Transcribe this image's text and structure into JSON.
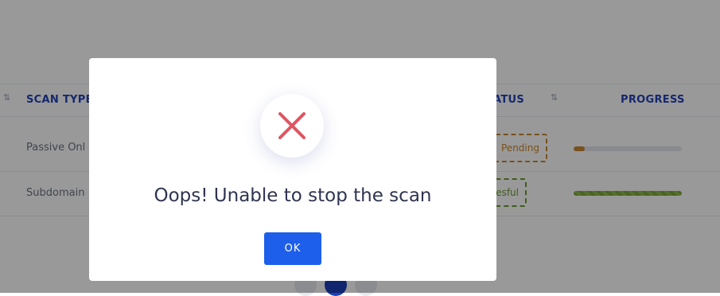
{
  "table": {
    "headers": {
      "scan_type": "SCAN TYPE",
      "status": "ATUS",
      "progress": "PROGRESS"
    },
    "rows": [
      {
        "scan_type": "Passive Onl",
        "status": "Pending",
        "progress": 0.1
      },
      {
        "scan_type": "Subdomain",
        "status": "ccesful",
        "progress": 1.0
      }
    ]
  },
  "modal": {
    "icon": "close-x-icon",
    "title": "Oops! Unable to stop the scan",
    "ok_label": "OK"
  },
  "colors": {
    "accent": "#1d5fea",
    "error": "#e05561",
    "header_text": "#2344b7",
    "pending": "#c8872f",
    "success": "#6a9a2f"
  }
}
